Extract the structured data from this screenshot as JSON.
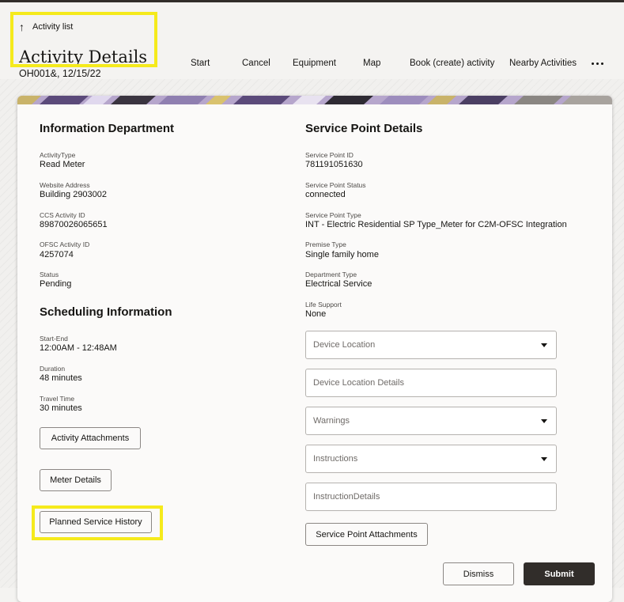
{
  "header": {
    "back_label": "Activity list",
    "title": "Activity Details",
    "subtitle": "OH001&, 12/15/22"
  },
  "toolbar": {
    "items": [
      "Start",
      "Cancel",
      "Equipment",
      "Map",
      "Book (create) activity",
      "Nearby Activities"
    ]
  },
  "info_section": {
    "title": "Information Department",
    "fields": [
      {
        "label": "ActivityType",
        "value": "Read Meter"
      },
      {
        "label": "Website Address",
        "value": "Building 2903002"
      },
      {
        "label": "CCS Activity ID",
        "value": "89870026065651"
      },
      {
        "label": "OFSC Activity ID",
        "value": "4257074"
      },
      {
        "label": "Status",
        "value": "Pending"
      }
    ]
  },
  "scheduling_section": {
    "title": "Scheduling Information",
    "fields": [
      {
        "label": "Start-End",
        "value": "12:00AM - 12:48AM"
      },
      {
        "label": "Duration",
        "value": "48 minutes"
      },
      {
        "label": "Travel Time",
        "value": "30 minutes"
      }
    ],
    "buttons": [
      "Activity Attachments",
      "Meter Details",
      "Planned Service History"
    ]
  },
  "service_point_section": {
    "title": "Service Point Details",
    "fields": [
      {
        "label": "Service Point ID",
        "value": "781191051630"
      },
      {
        "label": "Service Point Status",
        "value": "connected"
      },
      {
        "label": "Service Point Type",
        "value": "INT - Electric Residential SP Type_Meter for C2M-OFSC Integration"
      },
      {
        "label": "Premise Type",
        "value": "Single family home"
      },
      {
        "label": "Department Type",
        "value": "Electrical Service"
      },
      {
        "label": "Life Support",
        "value": "None"
      }
    ],
    "inputs": [
      {
        "placeholder": "Device Location",
        "type": "select"
      },
      {
        "placeholder": "Device Location Details",
        "type": "text"
      },
      {
        "placeholder": "Warnings",
        "type": "select"
      },
      {
        "placeholder": "Instructions",
        "type": "select"
      },
      {
        "placeholder": "InstructionDetails",
        "type": "text"
      }
    ],
    "attachments_button": "Service Point Attachments"
  },
  "footer": {
    "dismiss_label": "Dismiss",
    "submit_label": "Submit"
  },
  "colors": {
    "highlight": "#f5ea1c",
    "primary_button": "#312d2a",
    "card_background": "#fbfaf9"
  }
}
